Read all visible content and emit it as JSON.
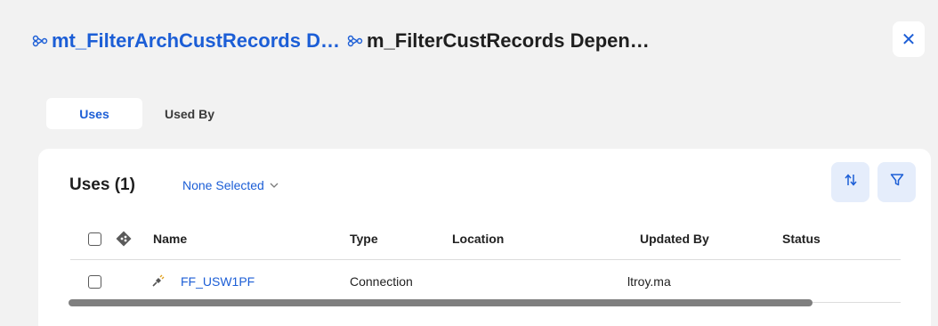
{
  "header": {
    "breadcrumb_link": "mt_FilterArchCustRecords D…",
    "current_title": "m_FilterCustRecords Depen…",
    "close_label": "✕"
  },
  "tabs": [
    {
      "label": "Uses",
      "active": true
    },
    {
      "label": "Used By",
      "active": false
    }
  ],
  "panel": {
    "title": "Uses (1)",
    "filter_select": "None Selected"
  },
  "table": {
    "columns": [
      "Name",
      "Type",
      "Location",
      "Updated By",
      "Status"
    ],
    "rows": [
      {
        "name": "FF_USW1PF",
        "type": "Connection",
        "location": "",
        "updated_by": "ltroy.ma",
        "status": ""
      }
    ]
  },
  "icons": {
    "breadcrumb_icon": "mapping-icon",
    "sort_icon": "sort-arrows-icon",
    "filter_icon": "funnel-icon",
    "git_icon": "git-icon",
    "connection_icon": "connection-plug-icon"
  },
  "colors": {
    "accent": "#1c5ed6",
    "background": "#f2f2f2",
    "button_tint": "#e5edfb"
  }
}
